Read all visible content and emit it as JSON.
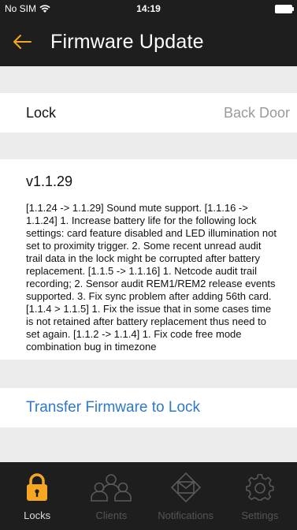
{
  "status_bar": {
    "carrier": "No SIM",
    "time": "14:19"
  },
  "nav": {
    "title": "Firmware Update"
  },
  "lock_row": {
    "label": "Lock",
    "value": "Back Door"
  },
  "firmware": {
    "version": "v1.1.29",
    "notes": "[1.1.24 -> 1.1.29] Sound mute support. [1.1.16 -> 1.1.24] 1. Increase battery life for the following lock settings: card feature disabled and LED illumination not set to proximity trigger. 2. Some recent unread audit trail data in the lock might be corrupted after battery replacement. [1.1.5 -> 1.1.16] 1. Netcode audit trail recording; 2. Sensor audit REM1/REM2 release events supported. 3. Fix sync problem after adding 56th card. [1.1.4 > 1.1.5] 1. Fix the issue that in some cases time is not retained after battery replacement thus need to set again. [1.1.2 -> 1.1.4] 1. Fix code free mode combination bug in timezone"
  },
  "action": {
    "transfer_label": "Transfer Firmware to Lock"
  },
  "tabs": [
    {
      "label": "Locks",
      "icon": "padlock-icon",
      "active": true
    },
    {
      "label": "Clients",
      "icon": "users-icon",
      "active": false
    },
    {
      "label": "Notifications",
      "icon": "envelope-icon",
      "active": false
    },
    {
      "label": "Settings",
      "icon": "gear-icon",
      "active": false
    }
  ],
  "colors": {
    "accent": "#f5a623",
    "link": "#2f79c5",
    "bar": "#1e1e1e",
    "background": "#ececec",
    "inactive": "#555555"
  }
}
